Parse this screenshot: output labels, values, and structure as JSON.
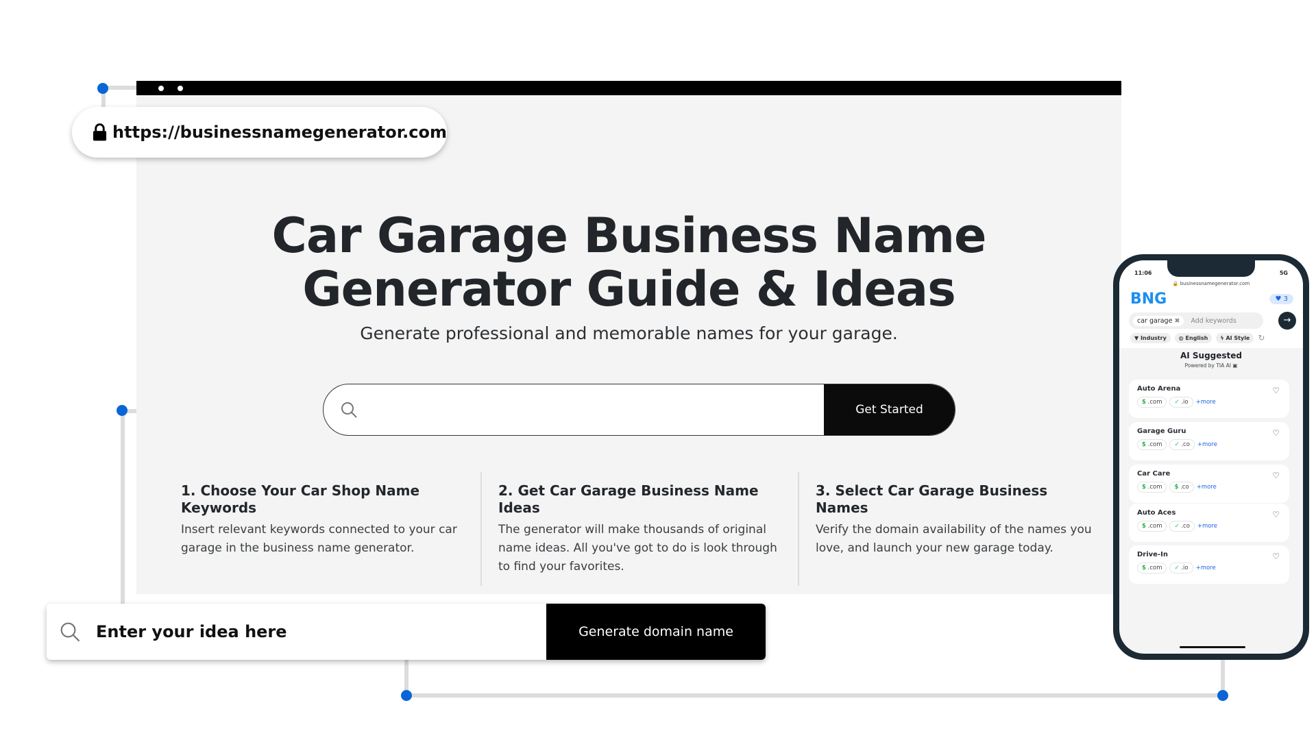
{
  "browser": {
    "url": "https://businessnamegenerator.com"
  },
  "hero": {
    "title_line1": "Car Garage Business Name",
    "title_line2": "Generator Guide & Ideas",
    "subtitle": "Generate professional and memorable names for your garage.",
    "search_placeholder": "",
    "button": "Get Started"
  },
  "steps": [
    {
      "title": "1. Choose Your Car Shop Name Keywords",
      "text": "Insert relevant keywords connected to your car garage in the business name generator."
    },
    {
      "title": "2. Get Car Garage Business Name Ideas",
      "text": "The generator will make thousands of original name ideas. All you've got to do is look through to find your favorites."
    },
    {
      "title": "3. Select Car Garage Business Names",
      "text": "Verify the domain availability of the names you love, and launch your new garage today."
    }
  ],
  "idea_bar": {
    "placeholder": "Enter your idea here",
    "button": "Generate domain name"
  },
  "phone": {
    "time": "11:06",
    "signal": "5G",
    "url": "businessnamegenerator.com",
    "logo": "BNG",
    "favorites_count": "3",
    "keyword": "car garage",
    "keywords_placeholder": "Add keywords",
    "filters": [
      "Industry",
      "English",
      "AI Style"
    ],
    "section_title": "AI Suggested",
    "powered_by": "Powered by TIA AI",
    "results": [
      {
        "name": "Auto Arena",
        "tags": [
          {
            "icon": "$",
            "ext": ".com"
          },
          {
            "icon": "✓",
            "ext": ".io"
          }
        ],
        "more": "+more"
      },
      {
        "name": "Garage Guru",
        "tags": [
          {
            "icon": "$",
            "ext": ".com"
          },
          {
            "icon": "✓",
            "ext": ".co"
          }
        ],
        "more": "+more"
      },
      {
        "name": "Car Care",
        "tags": [
          {
            "icon": "$",
            "ext": ".com"
          },
          {
            "icon": "$",
            "ext": ".co"
          }
        ],
        "more": "+more"
      },
      {
        "name": "Auto Aces",
        "tags": [
          {
            "icon": "$",
            "ext": ".com"
          },
          {
            "icon": "✓",
            "ext": ".co"
          }
        ],
        "more": "+more"
      },
      {
        "name": "Drive-In",
        "tags": [
          {
            "icon": "$",
            "ext": ".com"
          },
          {
            "icon": "✓",
            "ext": ".io"
          }
        ],
        "more": "+more"
      }
    ]
  },
  "colors": {
    "accent": "#0a66d6",
    "button": "#000000",
    "background": "#f3f4f3",
    "brand": "#1d8ef0"
  }
}
